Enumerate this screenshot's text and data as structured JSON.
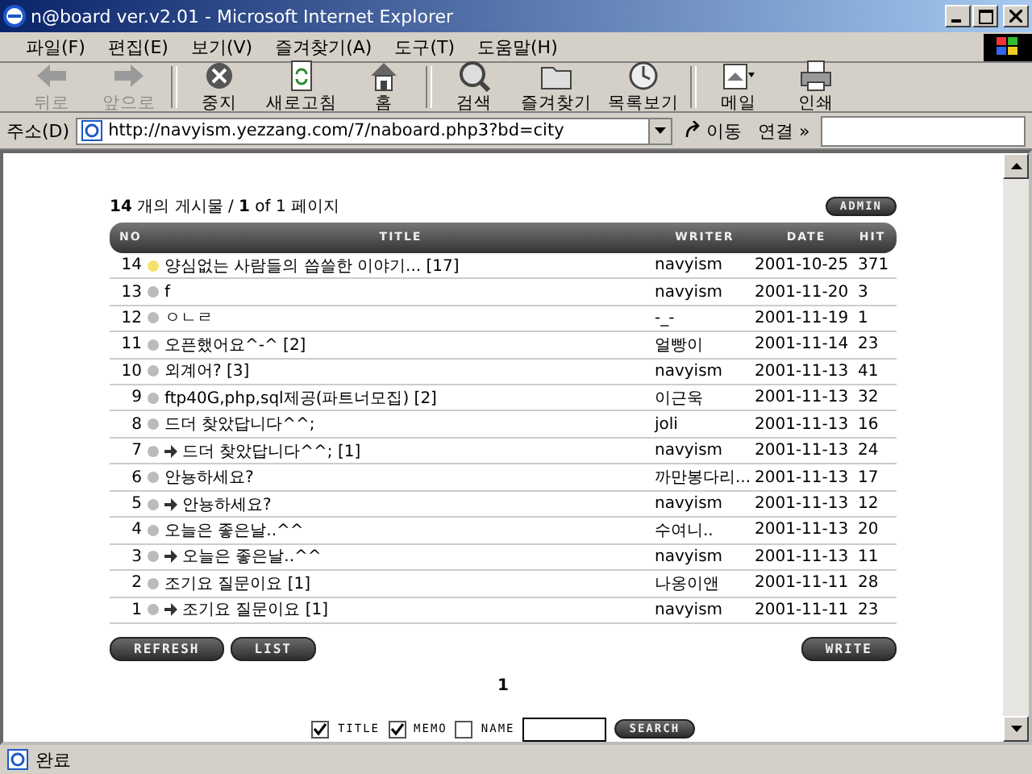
{
  "window": {
    "title": "n@board ver.v2.01 - Microsoft Internet Explorer"
  },
  "menu": [
    "파일(F)",
    "편집(E)",
    "보기(V)",
    "즐겨찾기(A)",
    "도구(T)",
    "도움말(H)"
  ],
  "toolbar": [
    {
      "label": "뒤로",
      "kind": "back",
      "disabled": true
    },
    {
      "label": "앞으로",
      "kind": "forward",
      "disabled": true
    },
    {
      "label": "중지",
      "kind": "stop",
      "disabled": false
    },
    {
      "label": "새로고침",
      "kind": "refresh",
      "disabled": false
    },
    {
      "label": "홈",
      "kind": "home",
      "disabled": false
    },
    {
      "label": "검색",
      "kind": "search",
      "disabled": false
    },
    {
      "label": "즐겨찾기",
      "kind": "favorites",
      "disabled": false
    },
    {
      "label": "목록보기",
      "kind": "history",
      "disabled": false
    },
    {
      "label": "메일",
      "kind": "mail",
      "disabled": false
    },
    {
      "label": "인쇄",
      "kind": "print",
      "disabled": false
    }
  ],
  "address": {
    "label": "주소(D)",
    "url": "http://navyism.yezzang.com/7/naboard.php3?bd=city",
    "go": "이동",
    "links": "연결 »"
  },
  "board": {
    "count": "14",
    "count_text": "개의 게시물 /",
    "page": "1",
    "page_text": "of 1 페이지",
    "admin": "ADMIN",
    "columns": [
      "NO",
      "TITLE",
      "WRITER",
      "DATE",
      "HIT"
    ],
    "rows": [
      {
        "no": "14",
        "title": "양심없는 사람들의 씁쓸한 이야기... [17]",
        "writer": "navyism",
        "date": "2001-10-25",
        "hit": "371",
        "new": true,
        "reply": false
      },
      {
        "no": "13",
        "title": "f",
        "writer": "navyism",
        "date": "2001-11-20",
        "hit": "3",
        "new": false,
        "reply": false
      },
      {
        "no": "12",
        "title": "ㅇㄴㄹ",
        "writer": "-_-",
        "date": "2001-11-19",
        "hit": "1",
        "new": false,
        "reply": false
      },
      {
        "no": "11",
        "title": "오픈했어요^-^ [2]",
        "writer": "얼빵이",
        "date": "2001-11-14",
        "hit": "23",
        "new": false,
        "reply": false
      },
      {
        "no": "10",
        "title": "외계어? [3]",
        "writer": "navyism",
        "date": "2001-11-13",
        "hit": "41",
        "new": false,
        "reply": false
      },
      {
        "no": "9",
        "title": "ftp40G,php,sql제공(파트너모집) [2]",
        "writer": "이근욱",
        "date": "2001-11-13",
        "hit": "32",
        "new": false,
        "reply": false
      },
      {
        "no": "8",
        "title": "드더 찾았답니다^^;",
        "writer": "joli",
        "date": "2001-11-13",
        "hit": "16",
        "new": false,
        "reply": false
      },
      {
        "no": "7",
        "title": "드더 찾았답니다^^; [1]",
        "writer": "navyism",
        "date": "2001-11-13",
        "hit": "24",
        "new": false,
        "reply": true
      },
      {
        "no": "6",
        "title": "안뇽하세요?",
        "writer": "까만봉다리...",
        "date": "2001-11-13",
        "hit": "17",
        "new": false,
        "reply": false
      },
      {
        "no": "5",
        "title": "안뇽하세요?",
        "writer": "navyism",
        "date": "2001-11-13",
        "hit": "12",
        "new": false,
        "reply": true
      },
      {
        "no": "4",
        "title": "오늘은 좋은날..^^",
        "writer": "수여니..",
        "date": "2001-11-13",
        "hit": "20",
        "new": false,
        "reply": false
      },
      {
        "no": "3",
        "title": "오늘은 좋은날..^^",
        "writer": "navyism",
        "date": "2001-11-13",
        "hit": "11",
        "new": false,
        "reply": true
      },
      {
        "no": "2",
        "title": "조기요 질문이요 [1]",
        "writer": "나옹이앤",
        "date": "2001-11-11",
        "hit": "28",
        "new": false,
        "reply": false
      },
      {
        "no": "1",
        "title": "조기요 질문이요 [1]",
        "writer": "navyism",
        "date": "2001-11-11",
        "hit": "23",
        "new": false,
        "reply": true
      }
    ],
    "buttons_left": [
      "REFRESH",
      "LIST"
    ],
    "button_right": "WRITE",
    "pages": [
      "1"
    ],
    "search": {
      "options": [
        {
          "label": "TITLE",
          "checked": true
        },
        {
          "label": "MEMO",
          "checked": true
        },
        {
          "label": "NAME",
          "checked": false
        }
      ],
      "button": "SEARCH"
    }
  },
  "status_bar": {
    "text": "완료"
  }
}
